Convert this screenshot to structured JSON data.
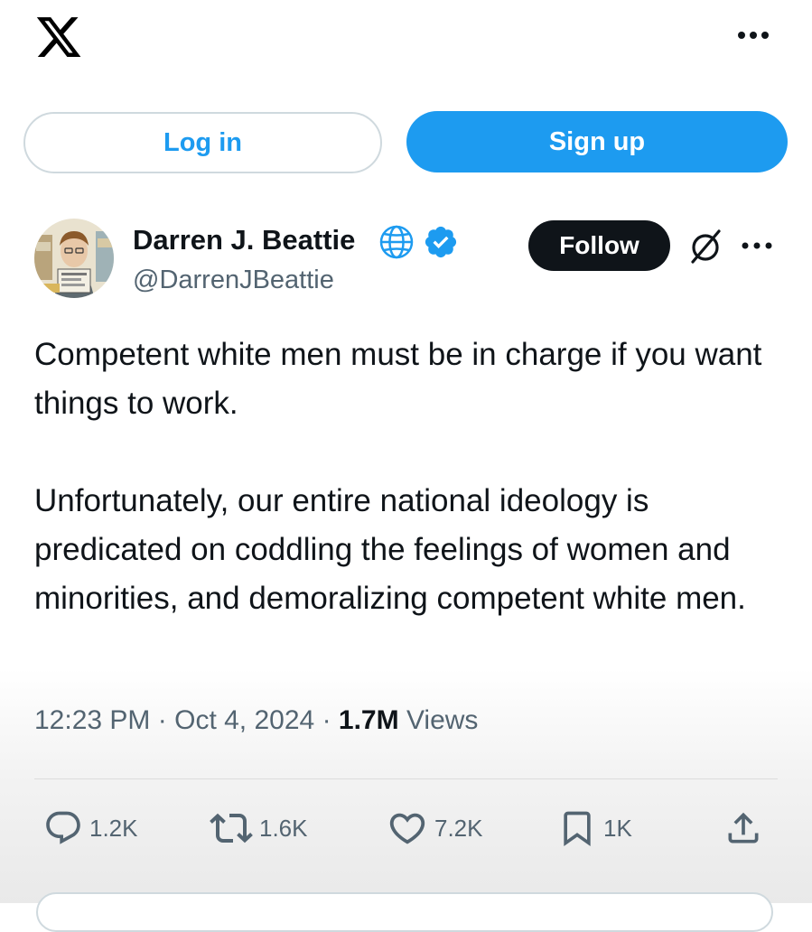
{
  "header": {
    "logo_icon": "x-logo-icon",
    "more_icon": "more-horizontal-icon"
  },
  "auth": {
    "login_label": "Log in",
    "signup_label": "Sign up"
  },
  "author": {
    "name": "Darren J. Beattie",
    "handle": "@DarrenJBeattie",
    "badges": [
      "globe-icon",
      "verified-icon"
    ],
    "follow_label": "Follow",
    "grok_icon": "grok-icon",
    "more_icon": "more-horizontal-icon"
  },
  "tweet": {
    "paragraphs": [
      "Competent white men must be in charge if you want things to work.",
      "Unfortunately, our entire national ideology is predicated on coddling the feelings of women and minorities, and demoralizing competent white men."
    ],
    "time": "12:23 PM",
    "date": "Oct 4, 2024",
    "separator": "·",
    "views_count": "1.7M",
    "views_label": "Views"
  },
  "actions": {
    "replies": "1.2K",
    "reposts": "1.6K",
    "likes": "7.2K",
    "bookmarks": "1K"
  },
  "colors": {
    "accent": "#1d9bf0",
    "text": "#0f1419",
    "secondary": "#536471",
    "border": "#cfd9de",
    "follow_bg": "#0f1419"
  }
}
